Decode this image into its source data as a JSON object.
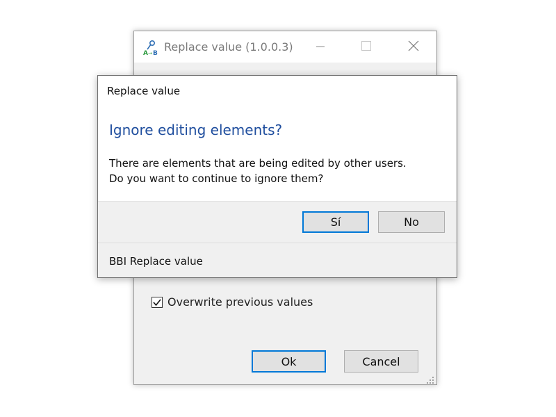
{
  "window": {
    "title": "Replace value (1.0.0.3)",
    "app_icon": "ab-replace-icon",
    "controls": {
      "minimize": "minimize-icon",
      "maximize": "maximize-icon",
      "close": "close-icon"
    },
    "overwrite_checkbox": {
      "label": "Overwrite previous values",
      "checked": true
    },
    "ok_label": "Ok",
    "cancel_label": "Cancel"
  },
  "dialog": {
    "title": "Replace value",
    "heading": "Ignore editing elements?",
    "message_line1": "There are elements that are being edited by other users.",
    "message_line2": "Do you want to continue to ignore them?",
    "yes_label": "Sí",
    "no_label": "No",
    "footer": "BBI Replace value",
    "colors": {
      "heading": "#1f4e9e",
      "accent": "#0078d7"
    }
  }
}
